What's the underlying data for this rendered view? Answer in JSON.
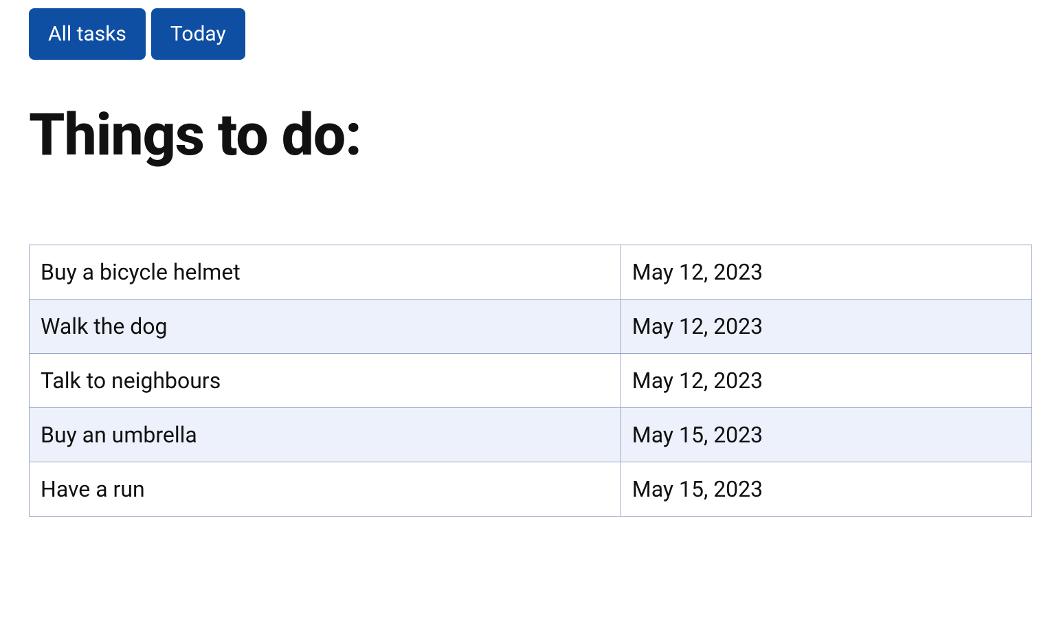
{
  "buttons": {
    "all_tasks": "All tasks",
    "today": "Today"
  },
  "heading": "Things to do:",
  "tasks": [
    {
      "title": "Buy a bicycle helmet",
      "date": "May 12, 2023"
    },
    {
      "title": "Walk the dog",
      "date": "May 12, 2023"
    },
    {
      "title": "Talk to neighbours",
      "date": "May 12, 2023"
    },
    {
      "title": "Buy an umbrella",
      "date": "May 15, 2023"
    },
    {
      "title": "Have a run",
      "date": "May 15, 2023"
    }
  ]
}
